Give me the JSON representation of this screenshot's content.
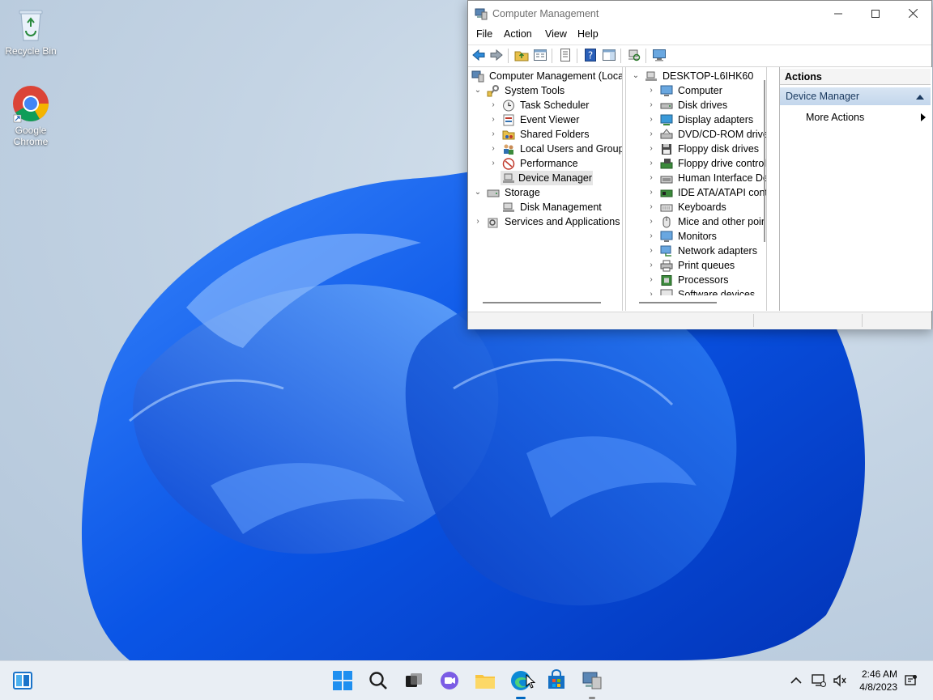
{
  "desktop": {
    "icons": [
      {
        "label": "Recycle Bin",
        "icon": "recycle-bin-icon"
      },
      {
        "label": "Google Chrome",
        "icon": "chrome-icon"
      }
    ]
  },
  "window": {
    "title": "Computer Management",
    "menu": [
      "File",
      "Action",
      "View",
      "Help"
    ],
    "left_tree": [
      {
        "label": "Computer Management (Local",
        "icon": "computer-management-icon",
        "level": 0
      },
      {
        "label": "System Tools",
        "icon": "system-tools-icon",
        "level": 1,
        "expanded": true
      },
      {
        "label": "Task Scheduler",
        "icon": "clock-icon",
        "level": 2
      },
      {
        "label": "Event Viewer",
        "icon": "event-viewer-icon",
        "level": 2
      },
      {
        "label": "Shared Folders",
        "icon": "shared-folder-icon",
        "level": 2
      },
      {
        "label": "Local Users and Groups",
        "icon": "users-icon",
        "level": 2
      },
      {
        "label": "Performance",
        "icon": "performance-icon",
        "level": 2
      },
      {
        "label": "Device Manager",
        "icon": "device-manager-icon",
        "level": 2,
        "selected": true
      },
      {
        "label": "Storage",
        "icon": "storage-icon",
        "level": 1,
        "expanded": true
      },
      {
        "label": "Disk Management",
        "icon": "disk-icon",
        "level": 2
      },
      {
        "label": "Services and Applications",
        "icon": "services-icon",
        "level": 1
      }
    ],
    "device_tree": {
      "root": "DESKTOP-L6IHK60",
      "items": [
        {
          "label": "Computer",
          "icon": "monitor-icon"
        },
        {
          "label": "Disk drives",
          "icon": "disk-drive-icon"
        },
        {
          "label": "Display adapters",
          "icon": "display-adapter-icon"
        },
        {
          "label": "DVD/CD-ROM drive",
          "icon": "dvd-icon"
        },
        {
          "label": "Floppy disk drives",
          "icon": "floppy-icon"
        },
        {
          "label": "Floppy drive control",
          "icon": "floppy-controller-icon"
        },
        {
          "label": "Human Interface De",
          "icon": "hid-icon"
        },
        {
          "label": "IDE ATA/ATAPI contr",
          "icon": "ide-icon"
        },
        {
          "label": "Keyboards",
          "icon": "keyboard-icon"
        },
        {
          "label": "Mice and other poir",
          "icon": "mouse-icon"
        },
        {
          "label": "Monitors",
          "icon": "monitor-icon"
        },
        {
          "label": "Network adapters",
          "icon": "network-icon"
        },
        {
          "label": "Print queues",
          "icon": "printer-icon"
        },
        {
          "label": "Processors",
          "icon": "processor-icon"
        },
        {
          "label": "Software devices",
          "icon": "software-device-icon"
        }
      ]
    },
    "actions": {
      "header": "Actions",
      "group": "Device Manager",
      "more": "More Actions"
    }
  },
  "taskbar": {
    "time": "2:46 AM",
    "date": "4/8/2023"
  },
  "colors": {
    "accent": "#0067c0",
    "selection": "#e5e5e5",
    "actions_group": "#c3d6ec"
  }
}
